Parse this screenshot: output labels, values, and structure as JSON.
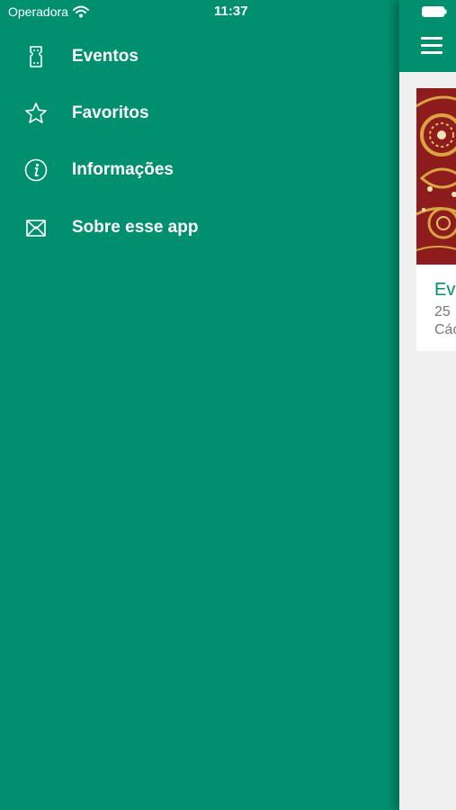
{
  "status_bar": {
    "carrier": "Operadora",
    "time": "11:37",
    "icons": [
      "wifi-icon",
      "battery-icon"
    ]
  },
  "drawer": {
    "items": [
      {
        "label": "Eventos",
        "icon": "ticket-icon"
      },
      {
        "label": "Favoritos",
        "icon": "star-icon"
      },
      {
        "label": "Informações",
        "icon": "info-icon"
      },
      {
        "label": "Sobre esse app",
        "icon": "envelope-icon"
      }
    ]
  },
  "content": {
    "menu_icon": "hamburger-icon",
    "event_card": {
      "title": "Ev",
      "date": "25",
      "place": "Các"
    }
  },
  "colors": {
    "primary": "#00906f",
    "text_on_primary": "#ffffff",
    "content_background": "#f0f0f0",
    "card_title": "#00906f",
    "card_subtext": "#777777",
    "image_red": "#8e1c1c",
    "image_gold": "#d9a441"
  }
}
